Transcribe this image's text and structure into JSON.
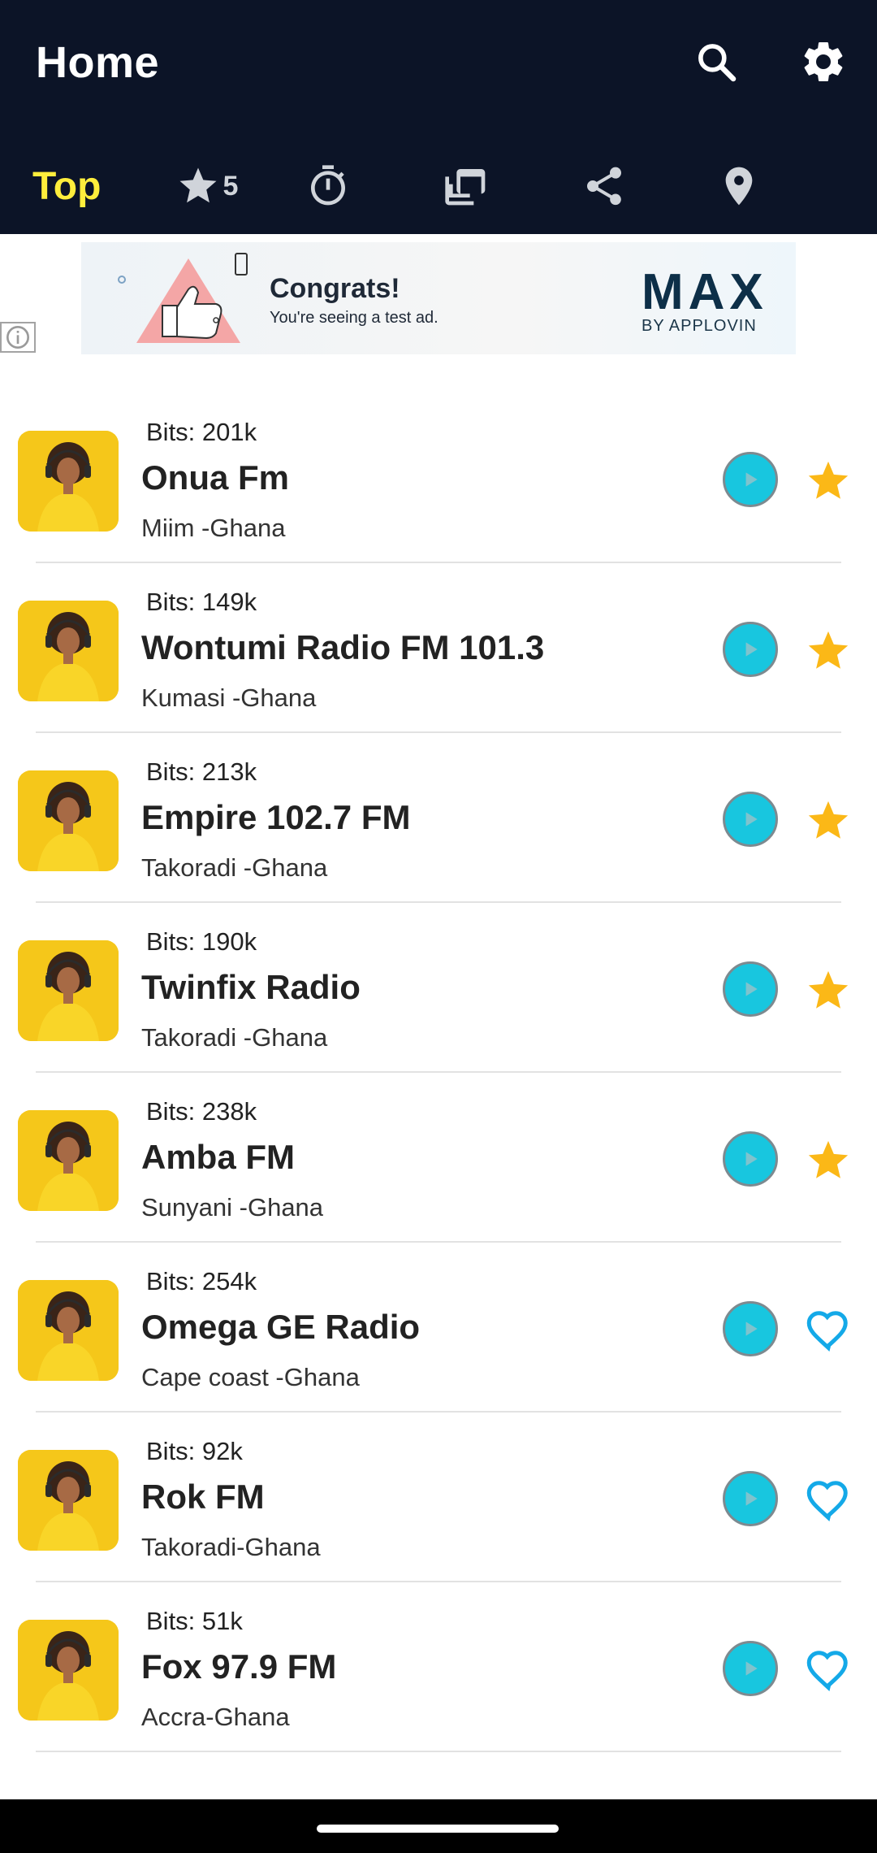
{
  "app_bar": {
    "title": "Home",
    "search_icon": "search-icon",
    "settings_icon": "gear-icon"
  },
  "tabs": {
    "top_label": "Top",
    "favorites_count": "5",
    "icons": [
      "star-icon",
      "timer-icon",
      "recent-icon",
      "share-icon",
      "location-icon"
    ]
  },
  "ad": {
    "title": "Congrats!",
    "subtitle": "You're seeing a test ad.",
    "brand": "MAX",
    "brand_sub": "BY APPLOVIN",
    "info_icon": "info-icon"
  },
  "colors": {
    "appbar": "#0c1427",
    "accent_yellow": "#ffee3c",
    "play": "#18c6df",
    "star": "#fbb817",
    "heart": "#14a9e8"
  },
  "stations": [
    {
      "bits": "Bits: 201k",
      "name": "Onua Fm",
      "location": "Miim -Ghana",
      "favorite": true
    },
    {
      "bits": "Bits: 149k",
      "name": "Wontumi Radio FM 101.3",
      "location": "Kumasi -Ghana",
      "favorite": true
    },
    {
      "bits": "Bits: 213k",
      "name": "Empire 102.7 FM",
      "location": "Takoradi -Ghana",
      "favorite": true
    },
    {
      "bits": "Bits: 190k",
      "name": "Twinfix Radio",
      "location": "Takoradi -Ghana",
      "favorite": true
    },
    {
      "bits": "Bits: 238k",
      "name": "Amba FM",
      "location": "Sunyani -Ghana",
      "favorite": true
    },
    {
      "bits": "Bits: 254k",
      "name": "Omega GE Radio",
      "location": "Cape coast -Ghana",
      "favorite": false
    },
    {
      "bits": "Bits: 92k",
      "name": "Rok FM",
      "location": "Takoradi-Ghana",
      "favorite": false
    },
    {
      "bits": "Bits: 51k",
      "name": "Fox 97.9 FM",
      "location": "Accra-Ghana",
      "favorite": false
    }
  ]
}
